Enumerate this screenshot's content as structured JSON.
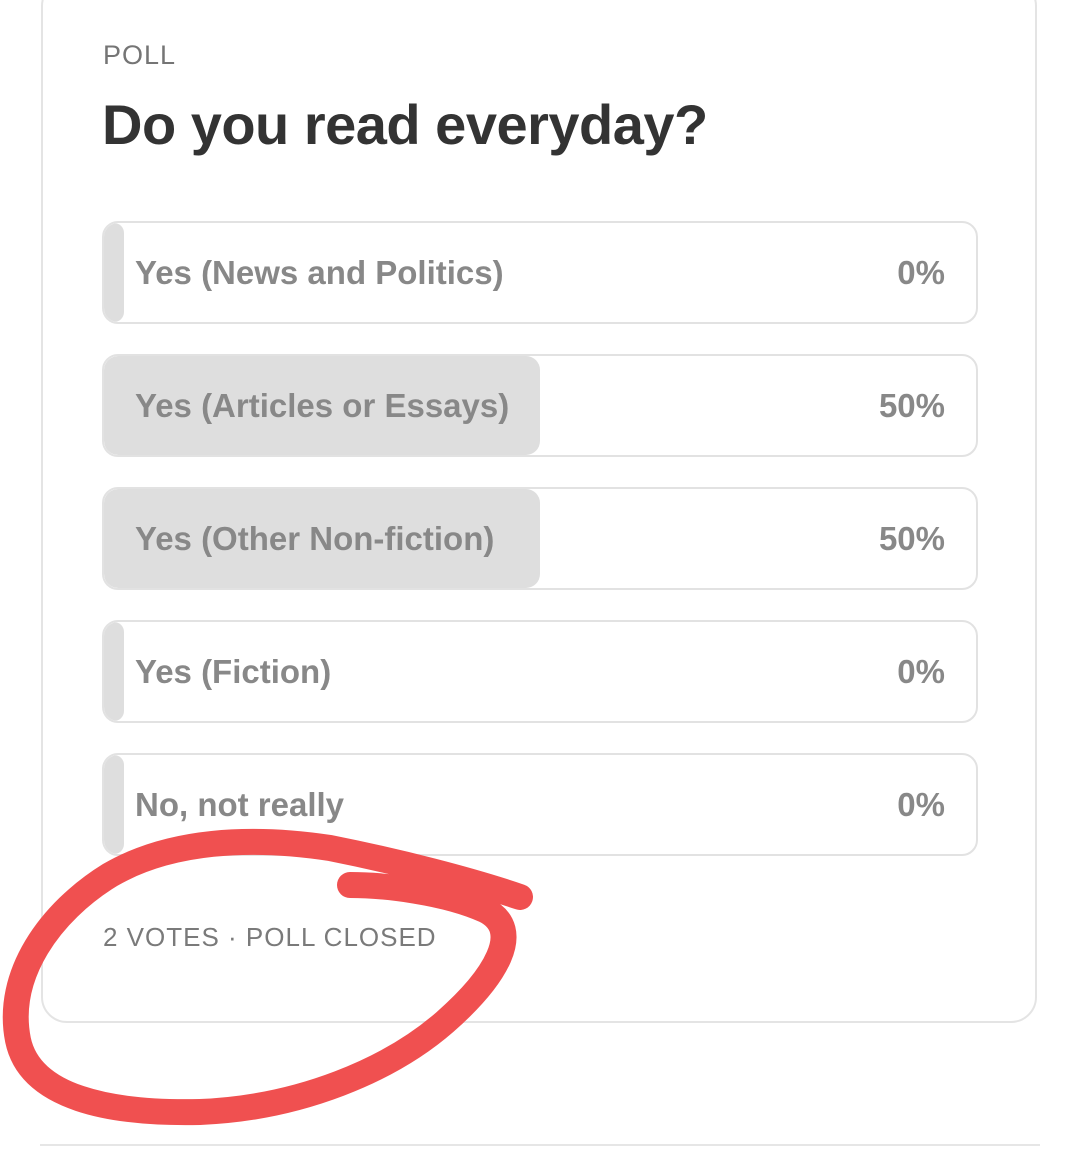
{
  "poll": {
    "label": "POLL",
    "question": "Do you read everyday?",
    "options": [
      {
        "label": "Yes (News and Politics)",
        "percent": "0%",
        "share": 0
      },
      {
        "label": "Yes (Articles or Essays)",
        "percent": "50%",
        "share": 0.5
      },
      {
        "label": "Yes (Other Non-fiction)",
        "percent": "50%",
        "share": 0.5
      },
      {
        "label": "Yes (Fiction)",
        "percent": "0%",
        "share": 0
      },
      {
        "label": "No, not really",
        "percent": "0%",
        "share": 0
      }
    ],
    "footer": "2 VOTES · POLL CLOSED"
  },
  "colors": {
    "bar_fill": "#dedede",
    "annotation_red": "#f05050"
  }
}
